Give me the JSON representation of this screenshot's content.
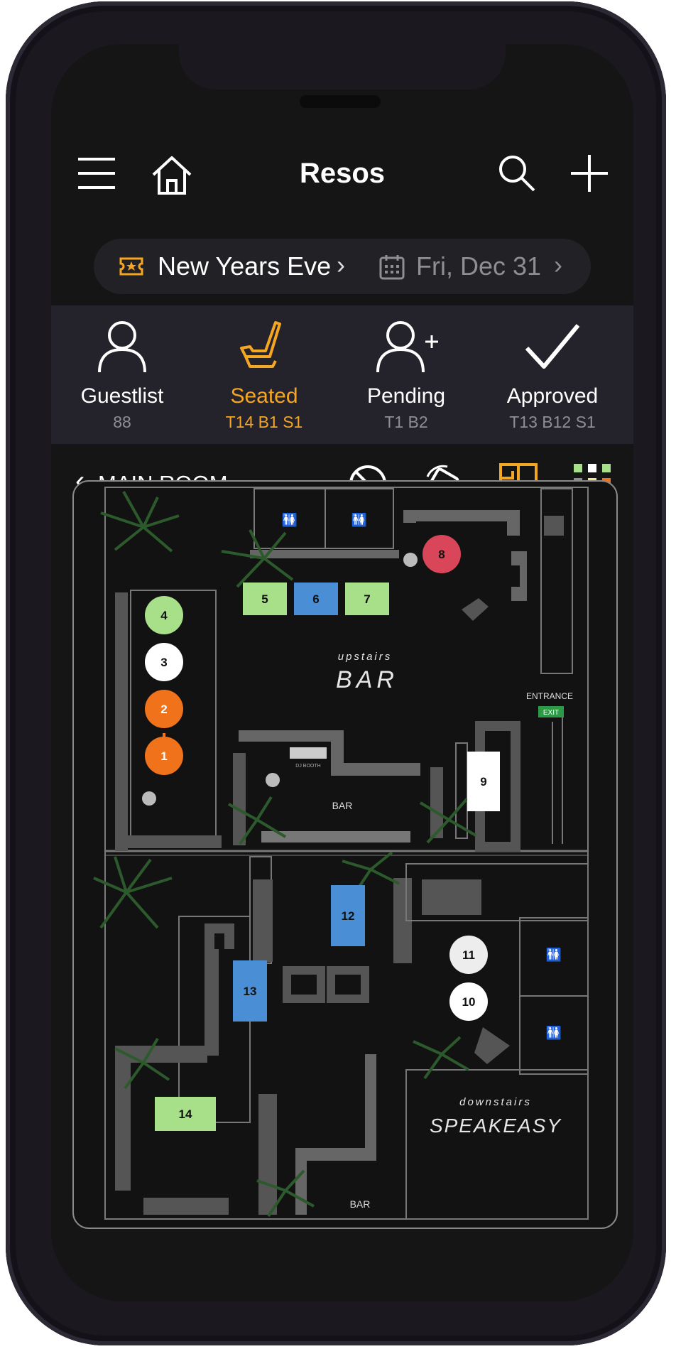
{
  "header": {
    "title": "Resos"
  },
  "filters": {
    "event": "New Years Eve",
    "date": "Fri, Dec 31"
  },
  "tabs": [
    {
      "label": "Guestlist",
      "sub": "88",
      "active": false
    },
    {
      "label": "Seated",
      "sub": "T14 B1 S1",
      "active": true
    },
    {
      "label": "Pending",
      "sub": "T1 B2",
      "active": false
    },
    {
      "label": "Approved",
      "sub": "T13 B12 S1",
      "active": false
    }
  ],
  "room": {
    "name": "MAIN ROOM"
  },
  "floorplan": {
    "tables": [
      "1",
      "2",
      "3",
      "4",
      "5",
      "6",
      "7",
      "8",
      "9",
      "10",
      "11",
      "12",
      "13",
      "14"
    ],
    "upstairs_sign": "upstairs",
    "upstairs_bar": "BAR",
    "downstairs_sign": "downstairs",
    "speakeasy": "SPEAKEASY",
    "bar_label": "BAR",
    "bar_label_2": "BAR",
    "entrance": "ENTRANCE",
    "exit": "EXIT",
    "dj_booth": "DJ BOOTH"
  },
  "colors": {
    "accent": "#f5a623",
    "green": "#a8e08a",
    "blue": "#4a8fd6",
    "orange": "#f0731c",
    "red": "#d9465a"
  }
}
